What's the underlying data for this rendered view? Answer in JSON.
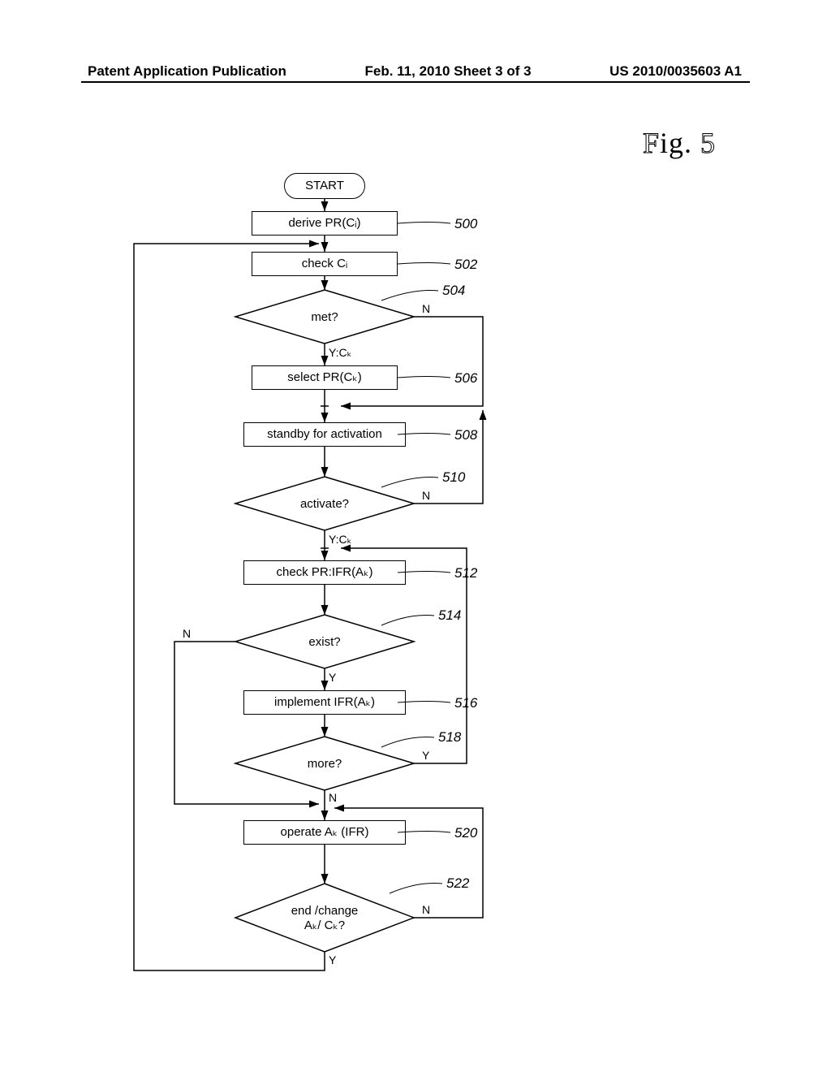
{
  "header": {
    "left": "Patent Application Publication",
    "center": "Feb. 11, 2010  Sheet 3 of 3",
    "right": "US 2010/0035603 A1"
  },
  "figure_title": "Fig. 5",
  "flowchart": {
    "start": "START",
    "n500": "derive PR(Cᵢ)",
    "n502": "check Cᵢ",
    "n504": "met?",
    "n506": "select PR(Cₖ)",
    "n508": "standby for activation",
    "n510": "activate?",
    "n512": "check PR:IFR(Aₖ)",
    "n514": "exist?",
    "n516": "implement IFR(Aₖ)",
    "n518": "more?",
    "n520": "operate Aₖ (IFR)",
    "n522": "end /change\nAₖ/ Cₖ?"
  },
  "refs": {
    "r500": "500",
    "r502": "502",
    "r504": "504",
    "r506": "506",
    "r508": "508",
    "r510": "510",
    "r512": "512",
    "r514": "514",
    "r516": "516",
    "r518": "518",
    "r520": "520",
    "r522": "522"
  },
  "labels": {
    "n504_y": "Y:Cₖ",
    "n504_n": "N",
    "n510_y": "Y:Cₖ",
    "n510_n": "N",
    "n514_y": "Y",
    "n514_n": "N",
    "n518_y": "Y",
    "n518_n": "N",
    "n522_y": "Y",
    "n522_n": "N"
  },
  "chart_data": {
    "type": "flowchart",
    "nodes": [
      {
        "id": "start",
        "shape": "terminator",
        "label": "START"
      },
      {
        "id": "500",
        "shape": "process",
        "label": "derive PR(C_i)"
      },
      {
        "id": "502",
        "shape": "process",
        "label": "check C_i"
      },
      {
        "id": "504",
        "shape": "decision",
        "label": "met?"
      },
      {
        "id": "506",
        "shape": "process",
        "label": "select PR(C_k)"
      },
      {
        "id": "508",
        "shape": "process",
        "label": "standby for activation"
      },
      {
        "id": "510",
        "shape": "decision",
        "label": "activate?"
      },
      {
        "id": "512",
        "shape": "process",
        "label": "check PR:IFR(A_k)"
      },
      {
        "id": "514",
        "shape": "decision",
        "label": "exist?"
      },
      {
        "id": "516",
        "shape": "process",
        "label": "implement IFR(A_k)"
      },
      {
        "id": "518",
        "shape": "decision",
        "label": "more?"
      },
      {
        "id": "520",
        "shape": "process",
        "label": "operate A_k (IFR)"
      },
      {
        "id": "522",
        "shape": "decision",
        "label": "end / change A_k / C_k?"
      }
    ],
    "edges": [
      {
        "from": "start",
        "to": "500"
      },
      {
        "from": "500",
        "to": "502"
      },
      {
        "from": "502",
        "to": "504"
      },
      {
        "from": "504",
        "to": "506",
        "label": "Y:C_k"
      },
      {
        "from": "504",
        "to": "508",
        "label": "N",
        "via": "right-down"
      },
      {
        "from": "506",
        "to": "508"
      },
      {
        "from": "508",
        "to": "510"
      },
      {
        "from": "510",
        "to": "512",
        "label": "Y:C_K"
      },
      {
        "from": "510",
        "to": "508",
        "label": "N",
        "via": "right-up"
      },
      {
        "from": "512",
        "to": "514"
      },
      {
        "from": "514",
        "to": "516",
        "label": "Y"
      },
      {
        "from": "514",
        "to": "520",
        "label": "N",
        "via": "left-down"
      },
      {
        "from": "516",
        "to": "518"
      },
      {
        "from": "518",
        "to": "512",
        "label": "Y",
        "via": "right-up"
      },
      {
        "from": "518",
        "to": "520",
        "label": "N"
      },
      {
        "from": "520",
        "to": "522"
      },
      {
        "from": "522",
        "to": "502",
        "label": "Y",
        "via": "left-up"
      },
      {
        "from": "522",
        "to": "520",
        "label": "N",
        "via": "right-up"
      }
    ]
  }
}
